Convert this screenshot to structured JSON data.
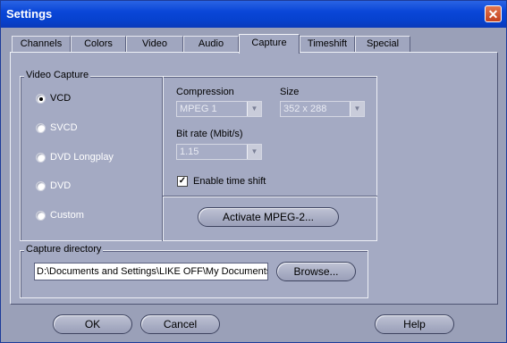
{
  "window": {
    "title": "Settings",
    "close_glyph": "✕"
  },
  "tabs": [
    {
      "label": "Channels"
    },
    {
      "label": "Colors"
    },
    {
      "label": "Video"
    },
    {
      "label": "Audio"
    },
    {
      "label": "Capture",
      "active": true
    },
    {
      "label": "Timeshift"
    },
    {
      "label": "Special"
    }
  ],
  "video_capture": {
    "title": "Video Capture",
    "formats": [
      {
        "label": "VCD",
        "selected": true
      },
      {
        "label": "SVCD"
      },
      {
        "label": "DVD Longplay"
      },
      {
        "label": "DVD"
      },
      {
        "label": "Custom"
      }
    ],
    "compression_label": "Compression",
    "compression_value": "MPEG 1",
    "size_label": "Size",
    "size_value": "352 x 288",
    "bitrate_label": "Bit rate (Mbit/s)",
    "bitrate_value": "1.15",
    "timeshift_label": "Enable time shift",
    "timeshift_checked": true,
    "activate_button": "Activate MPEG-2..."
  },
  "capture_directory": {
    "title": "Capture directory",
    "path": "D:\\Documents and Settings\\LIKE OFF\\My Documents",
    "browse_button": "Browse..."
  },
  "footer": {
    "ok": "OK",
    "cancel": "Cancel",
    "help": "Help"
  }
}
